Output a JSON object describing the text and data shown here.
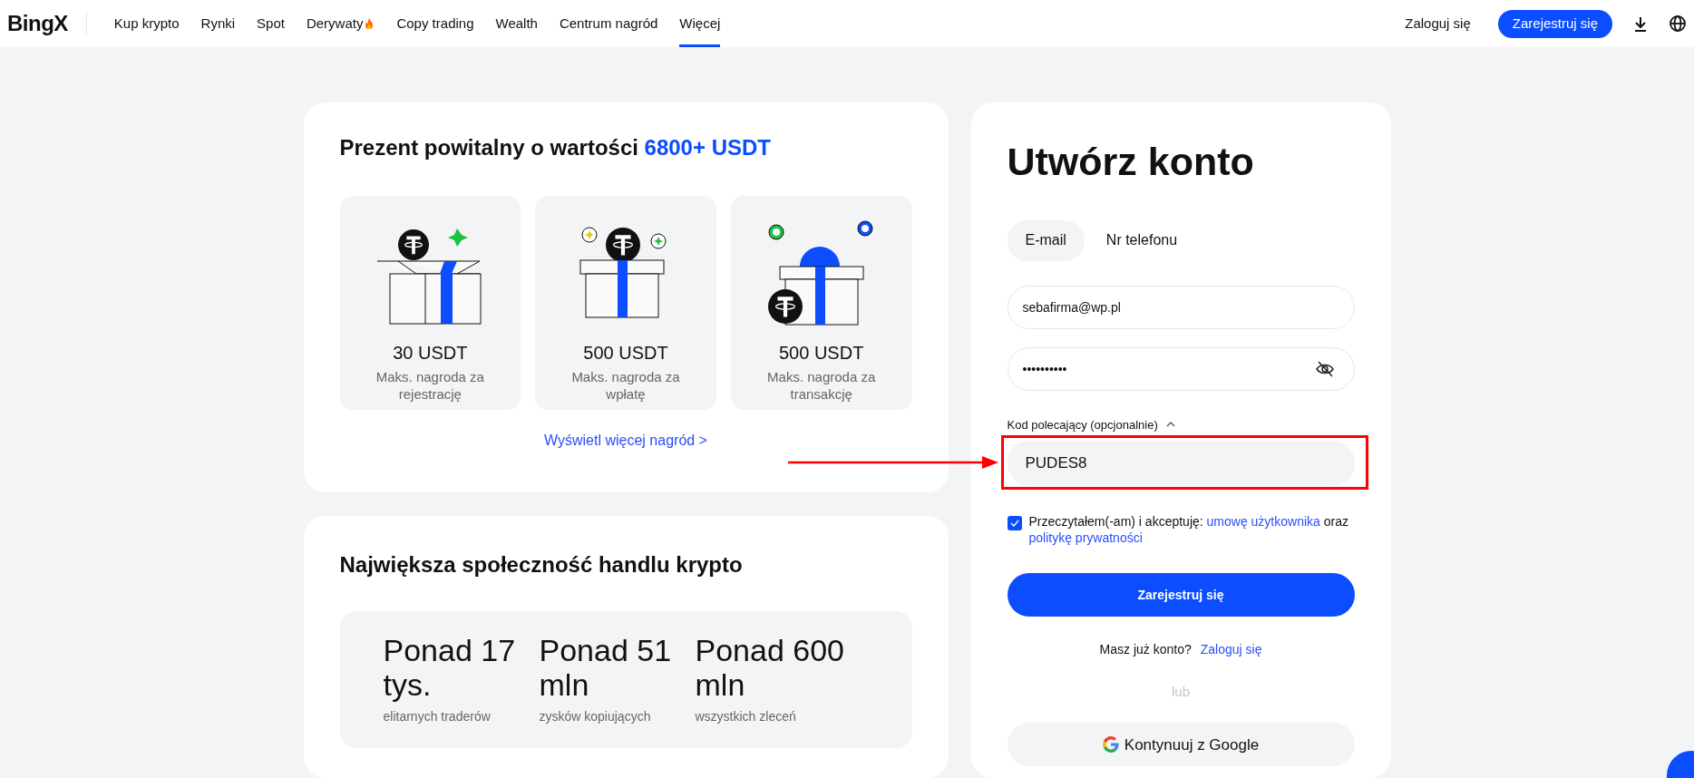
{
  "navbar": {
    "logo": "BingX",
    "items": [
      {
        "label": "Kup krypto",
        "selected": false,
        "hot": false
      },
      {
        "label": "Rynki",
        "selected": false,
        "hot": false
      },
      {
        "label": "Spot",
        "selected": false,
        "hot": false
      },
      {
        "label": "Derywaty",
        "selected": false,
        "hot": true
      },
      {
        "label": "Copy trading",
        "selected": false,
        "hot": false
      },
      {
        "label": "Wealth",
        "selected": false,
        "hot": false
      },
      {
        "label": "Centrum nagród",
        "selected": false,
        "hot": false
      },
      {
        "label": "Więcej",
        "selected": true,
        "hot": false
      }
    ],
    "login": "Zaloguj się",
    "register": "Zarejestruj się"
  },
  "welcome_gift": {
    "title": "Prezent powitalny o wartości",
    "title_highlight": "6800+ USDT",
    "rewards": [
      {
        "kind": "open_box",
        "amount": "30 USDT",
        "caption": "Maks. nagroda za rejestrację"
      },
      {
        "kind": "gift_box",
        "amount": "500 USDT",
        "caption": "Maks. nagroda za wpłatę"
      },
      {
        "kind": "gift_bow",
        "amount": "500 USDT",
        "caption": "Maks. nagroda za transakcję"
      }
    ],
    "more_link": "Wyświetl więcej nagród >"
  },
  "community": {
    "title": "Największa społeczność handlu krypto",
    "stats": [
      {
        "value": "Ponad 17 tys.",
        "label": "elitarnych traderów"
      },
      {
        "value": "Ponad 51 mln",
        "label": "zysków kopiujących"
      },
      {
        "value": "Ponad 600 mln",
        "label": "wszystkich zleceń"
      }
    ]
  },
  "signup": {
    "title": "Utwórz konto",
    "tabs": [
      {
        "label": "E-mail",
        "selected": true
      },
      {
        "label": "Nr telefonu",
        "selected": false
      }
    ],
    "email": "sebafirma@wp.pl",
    "password": "••••••••••",
    "referral": {
      "label": "Kod polecający (opcjonalnie)",
      "expanded": true,
      "value": "PUDES8"
    },
    "terms": {
      "checked": true,
      "text_before": "Przeczytałem(-am) i akceptuję:",
      "link_1": "umowę użytkownika",
      "text_middle": "oraz",
      "link_2": "politykę prywatności"
    },
    "submit": "Zarejestruj się",
    "have_account": "Masz już konto?",
    "login_link": "Zaloguj się",
    "or": "lub",
    "google": "Kontynuuj z Google"
  }
}
